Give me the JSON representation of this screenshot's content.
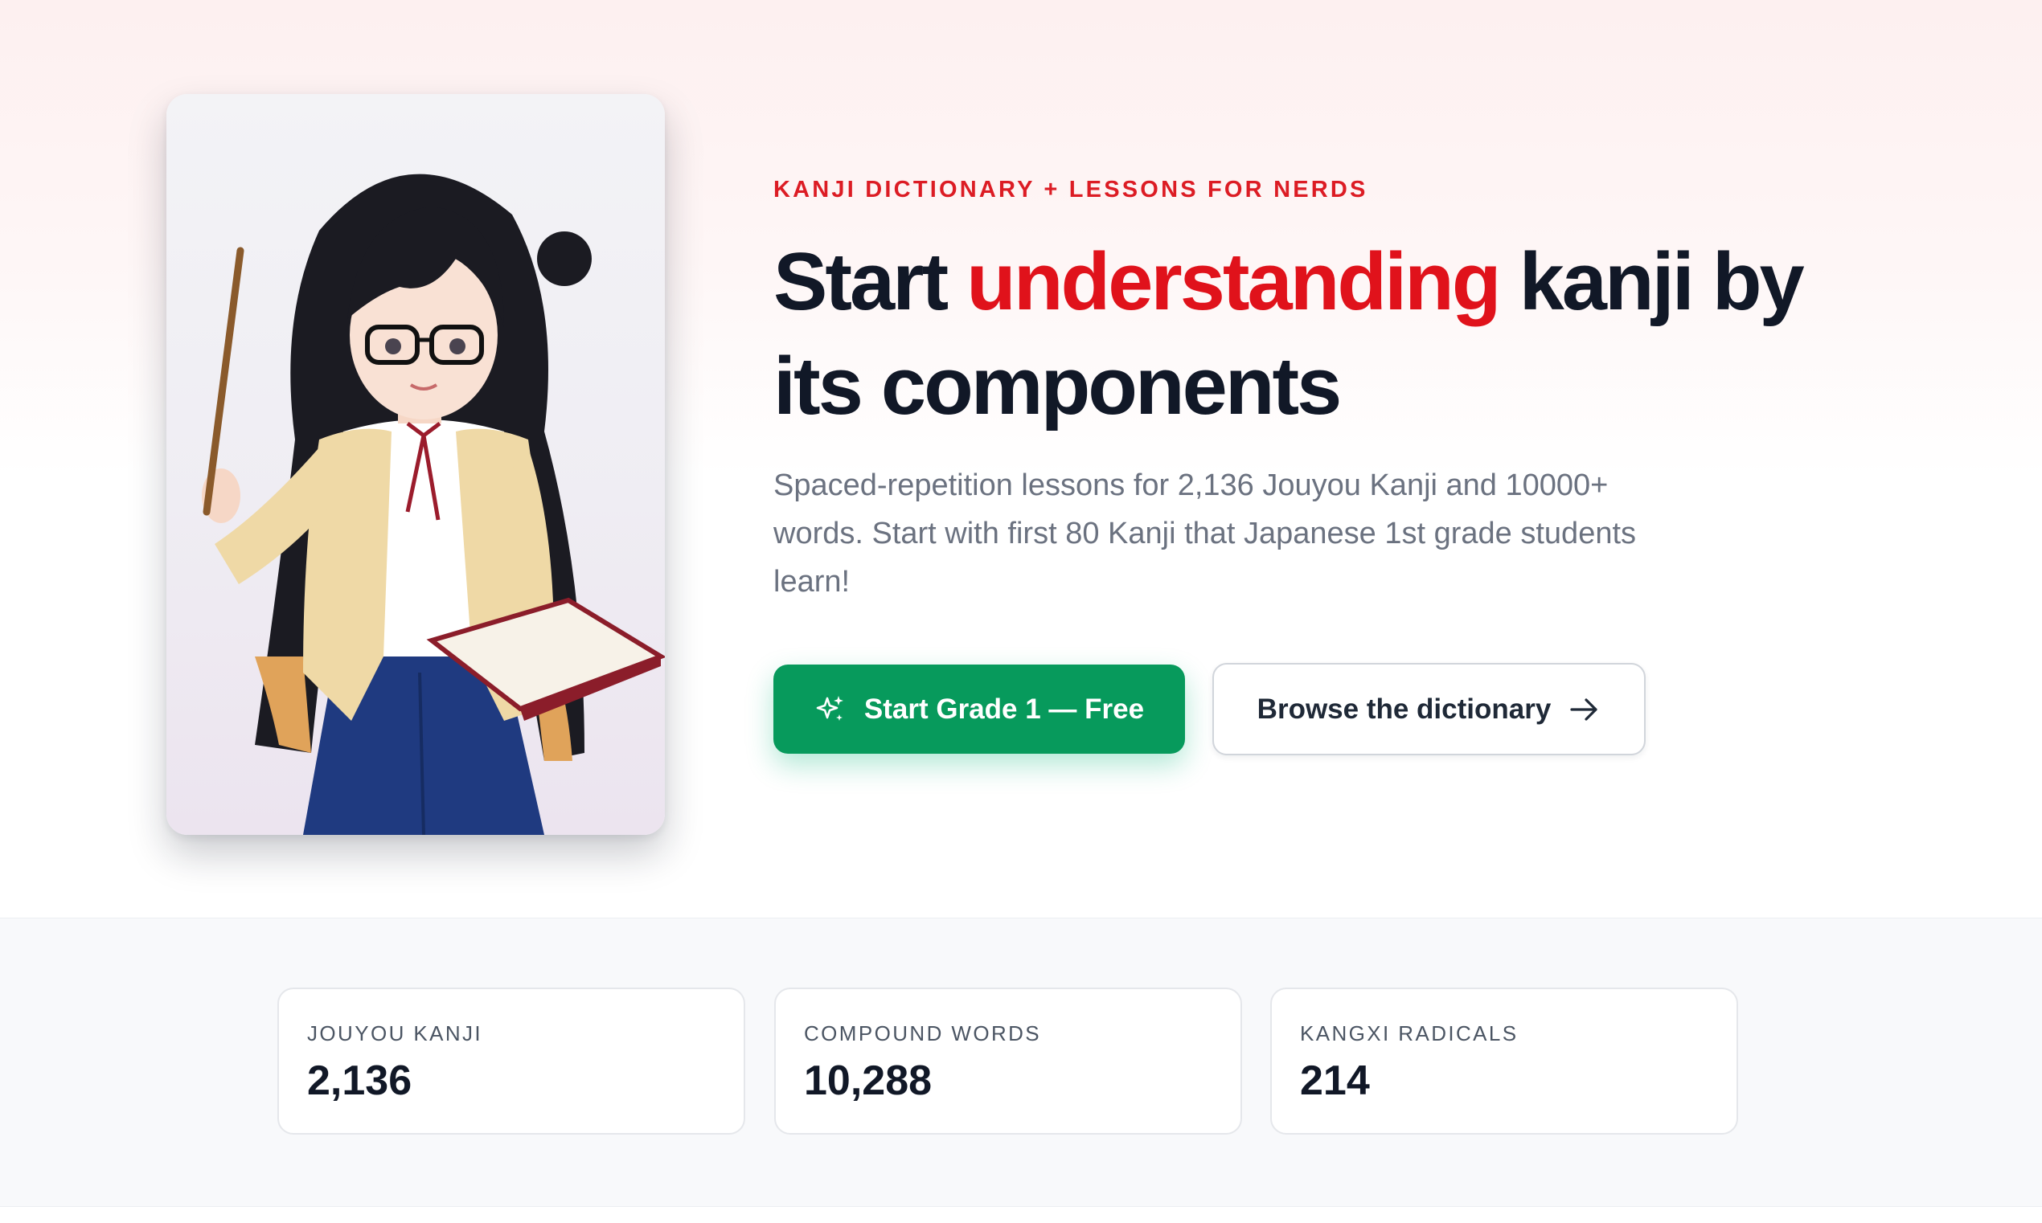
{
  "hero": {
    "eyebrow": "KANJI DICTIONARY + LESSONS FOR NERDS",
    "headline": {
      "part1": "Start ",
      "accent": "understanding",
      "part2": " kanji by its components"
    },
    "subhead": "Spaced-repetition lessons for 2,136 Jouyou Kanji and 10000+ words. Start with first 80 Kanji that Japanese 1st grade students learn!",
    "primary_button": {
      "label": "Start Grade 1 — Free",
      "icon": "sparkles-icon"
    },
    "secondary_button": {
      "label": "Browse the dictionary",
      "icon": "arrow-right-icon"
    },
    "illustration": "anime-teacher-illustration"
  },
  "stats": [
    {
      "label": "JOUYOU KANJI",
      "value": "2,136"
    },
    {
      "label": "COMPOUND WORDS",
      "value": "10,288"
    },
    {
      "label": "KANGXI RADICALS",
      "value": "214"
    }
  ],
  "colors": {
    "accent_red": "#e0121b",
    "primary_green": "#079a5c",
    "text_dark": "#111827",
    "text_muted": "#6b7280"
  }
}
